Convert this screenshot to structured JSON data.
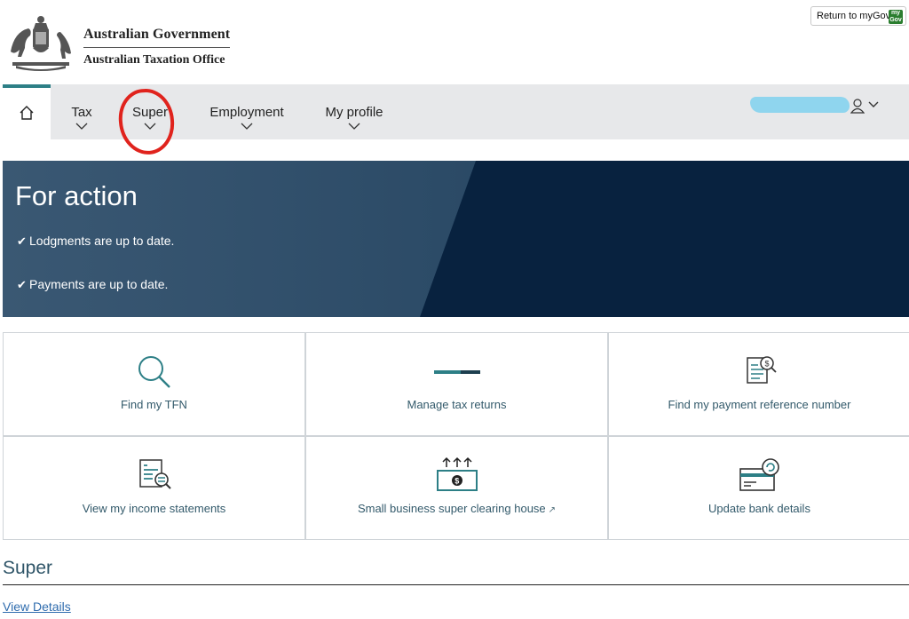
{
  "header": {
    "gov_line1": "Australian Government",
    "gov_line2": "Australian Taxation Office",
    "return_button": "Return to myGov",
    "mygov_logo": "my Gov"
  },
  "nav": {
    "items": [
      {
        "label": "Tax"
      },
      {
        "label": "Super"
      },
      {
        "label": "Employment"
      },
      {
        "label": "My profile"
      }
    ],
    "home_icon": "home-icon",
    "user_icon": "user-icon"
  },
  "banner": {
    "title": "For action",
    "items": [
      "Lodgments are up to date.",
      "Payments are up to date."
    ]
  },
  "tiles": [
    {
      "label": "Find my TFN",
      "icon": "magnifier-icon"
    },
    {
      "label": "Manage tax returns",
      "icon": "progress-bar-icon"
    },
    {
      "label": "Find my payment reference number",
      "icon": "document-search-icon"
    },
    {
      "label": "View my income statements",
      "icon": "statement-search-icon"
    },
    {
      "label": "Small business super clearing house",
      "icon": "money-upload-icon",
      "external": true
    },
    {
      "label": "Update bank details",
      "icon": "bank-card-refresh-icon"
    }
  ],
  "super_section": {
    "heading": "Super",
    "link": "View Details"
  },
  "colors": {
    "teal": "#2d7f86",
    "banner_dark": "#08223f",
    "banner_light": "#3f5d78",
    "nav_bg": "#e7e8ea",
    "link": "#2f6cae",
    "annotation_red": "#e0231d"
  }
}
